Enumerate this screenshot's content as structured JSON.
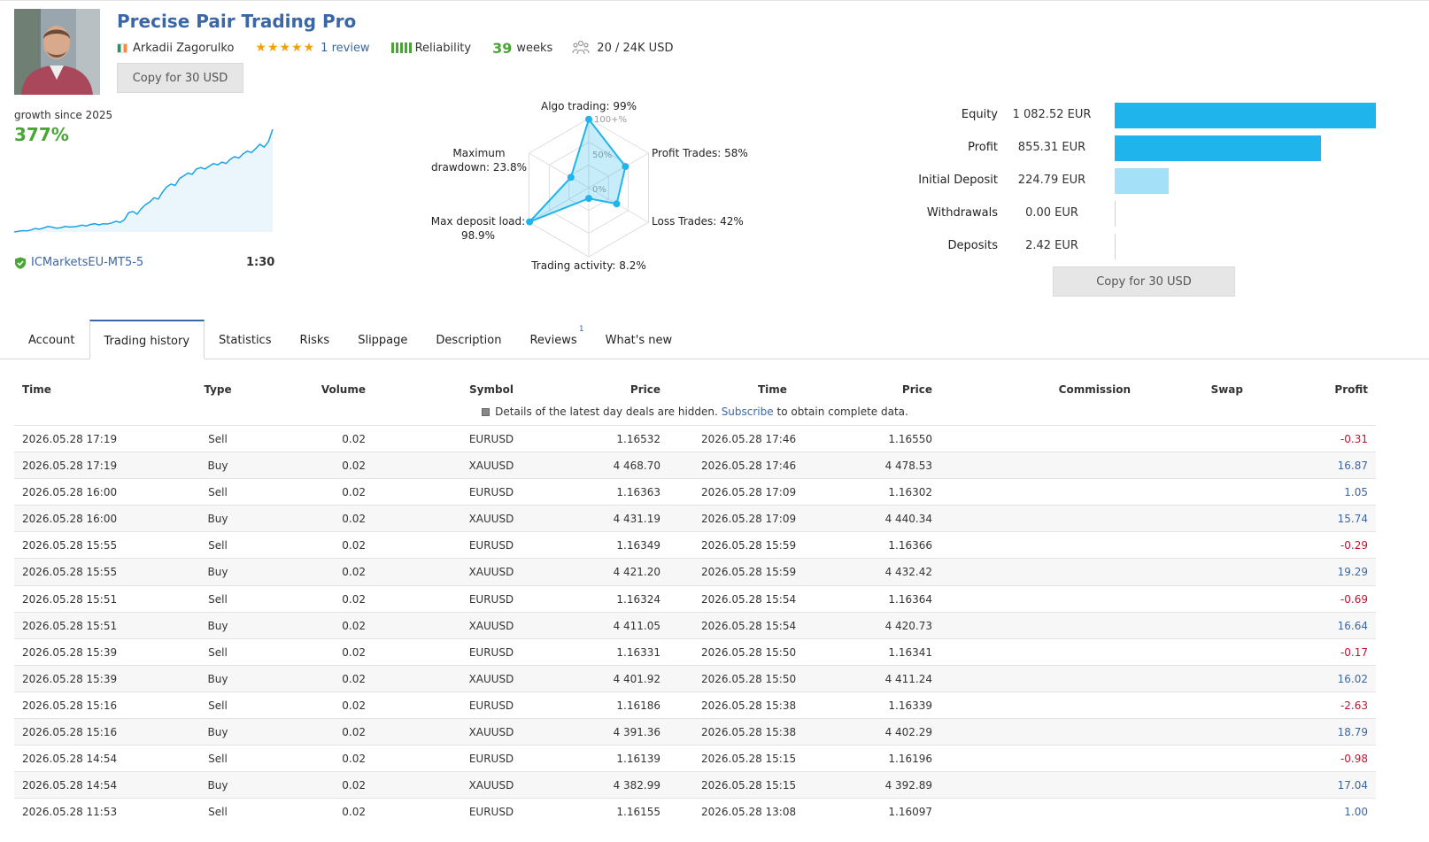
{
  "header": {
    "title": "Precise Pair Trading Pro",
    "author": "Arkadii Zagorulko",
    "stars": "★★★★★",
    "reviews": "1 review",
    "reliability_label": "Reliability",
    "weeks_value": "39",
    "weeks_label": "weeks",
    "subscribers": "20 / 24K USD",
    "copy_button": "Copy for 30 USD"
  },
  "growth": {
    "label": "growth since 2025",
    "value": "377%",
    "server": "ICMarketsEU-MT5-5",
    "leverage": "1:30",
    "curve": [
      0,
      0.5,
      1,
      0.8,
      1.5,
      2.5,
      2,
      3,
      4,
      3.5,
      2.8,
      3.2,
      4,
      3.6,
      3.8,
      4.2,
      5,
      4.4,
      5.5,
      6,
      5.2,
      6,
      5.8,
      6.6,
      7.8,
      7,
      9,
      14,
      15,
      13,
      17,
      20,
      22,
      25,
      24,
      29,
      33,
      35,
      34,
      39,
      41,
      43,
      42,
      46,
      47,
      46,
      48,
      50,
      49,
      51,
      50,
      53,
      55,
      54,
      57,
      59,
      58,
      61,
      64,
      62,
      66,
      75
    ]
  },
  "radar": {
    "algo_trading": "Algo trading: 99%",
    "profit_trades": "Profit Trades: 58%",
    "loss_trades": "Loss Trades: 42%",
    "trading_activity": "Trading activity: 8.2%",
    "max_deposit_load_1": "Max deposit load:",
    "max_deposit_load_2": "98.9%",
    "max_drawdown_1": "Maximum",
    "max_drawdown_2": "drawdown: 23.8%",
    "ring_100": "100+%",
    "ring_50": "50%",
    "ring_0": "0%",
    "values": [
      0.99,
      0.58,
      0.42,
      0.082,
      0.989,
      0.238
    ]
  },
  "balance": {
    "max": 1082.52,
    "items": [
      {
        "label": "Equity",
        "value": "1 082.52 EUR",
        "amount": 1082.52,
        "color": "#1fb5ec"
      },
      {
        "label": "Profit",
        "value": "855.31 EUR",
        "amount": 855.31,
        "color": "#1fb5ec"
      },
      {
        "label": "Initial Deposit",
        "value": "224.79 EUR",
        "amount": 224.79,
        "color": "#a4e1f8"
      },
      {
        "label": "Withdrawals",
        "value": "0.00 EUR",
        "amount": 0,
        "color": "#a4e1f8"
      },
      {
        "label": "Deposits",
        "value": "2.42 EUR",
        "amount": 2.42,
        "color": "#a4e1f8"
      }
    ]
  },
  "tabs": [
    {
      "label": "Account",
      "active": false
    },
    {
      "label": "Trading history",
      "active": true
    },
    {
      "label": "Statistics",
      "active": false
    },
    {
      "label": "Risks",
      "active": false
    },
    {
      "label": "Slippage",
      "active": false
    },
    {
      "label": "Description",
      "active": false
    },
    {
      "label": "Reviews",
      "active": false,
      "badge": "1"
    },
    {
      "label": "What's new",
      "active": false
    }
  ],
  "table": {
    "headers": {
      "time": "Time",
      "type": "Type",
      "volume": "Volume",
      "symbol": "Symbol",
      "price": "Price",
      "time2": "Time",
      "price2": "Price",
      "commission": "Commission",
      "swap": "Swap",
      "profit": "Profit"
    },
    "notice_text": "Details of the latest day deals are hidden.",
    "notice_link": "Subscribe",
    "notice_tail": "to obtain complete data.",
    "rows": [
      [
        "2026.05.28 17:19",
        "Sell",
        "0.02",
        "EURUSD",
        "1.16532",
        "2026.05.28 17:46",
        "1.16550",
        "-0.31"
      ],
      [
        "2026.05.28 17:19",
        "Buy",
        "0.02",
        "XAUUSD",
        "4 468.70",
        "2026.05.28 17:46",
        "4 478.53",
        "16.87"
      ],
      [
        "2026.05.28 16:00",
        "Sell",
        "0.02",
        "EURUSD",
        "1.16363",
        "2026.05.28 17:09",
        "1.16302",
        "1.05"
      ],
      [
        "2026.05.28 16:00",
        "Buy",
        "0.02",
        "XAUUSD",
        "4 431.19",
        "2026.05.28 17:09",
        "4 440.34",
        "15.74"
      ],
      [
        "2026.05.28 15:55",
        "Sell",
        "0.02",
        "EURUSD",
        "1.16349",
        "2026.05.28 15:59",
        "1.16366",
        "-0.29"
      ],
      [
        "2026.05.28 15:55",
        "Buy",
        "0.02",
        "XAUUSD",
        "4 421.20",
        "2026.05.28 15:59",
        "4 432.42",
        "19.29"
      ],
      [
        "2026.05.28 15:51",
        "Sell",
        "0.02",
        "EURUSD",
        "1.16324",
        "2026.05.28 15:54",
        "1.16364",
        "-0.69"
      ],
      [
        "2026.05.28 15:51",
        "Buy",
        "0.02",
        "XAUUSD",
        "4 411.05",
        "2026.05.28 15:54",
        "4 420.73",
        "16.64"
      ],
      [
        "2026.05.28 15:39",
        "Sell",
        "0.02",
        "EURUSD",
        "1.16331",
        "2026.05.28 15:50",
        "1.16341",
        "-0.17"
      ],
      [
        "2026.05.28 15:39",
        "Buy",
        "0.02",
        "XAUUSD",
        "4 401.92",
        "2026.05.28 15:50",
        "4 411.24",
        "16.02"
      ],
      [
        "2026.05.28 15:16",
        "Sell",
        "0.02",
        "EURUSD",
        "1.16186",
        "2026.05.28 15:38",
        "1.16339",
        "-2.63"
      ],
      [
        "2026.05.28 15:16",
        "Buy",
        "0.02",
        "XAUUSD",
        "4 391.36",
        "2026.05.28 15:38",
        "4 402.29",
        "18.79"
      ],
      [
        "2026.05.28 14:54",
        "Sell",
        "0.02",
        "EURUSD",
        "1.16139",
        "2026.05.28 15:15",
        "1.16196",
        "-0.98"
      ],
      [
        "2026.05.28 14:54",
        "Buy",
        "0.02",
        "XAUUSD",
        "4 382.99",
        "2026.05.28 15:15",
        "4 392.89",
        "17.04"
      ],
      [
        "2026.05.28 11:53",
        "Sell",
        "0.02",
        "EURUSD",
        "1.16155",
        "2026.05.28 13:08",
        "1.16097",
        "1.00"
      ]
    ]
  }
}
